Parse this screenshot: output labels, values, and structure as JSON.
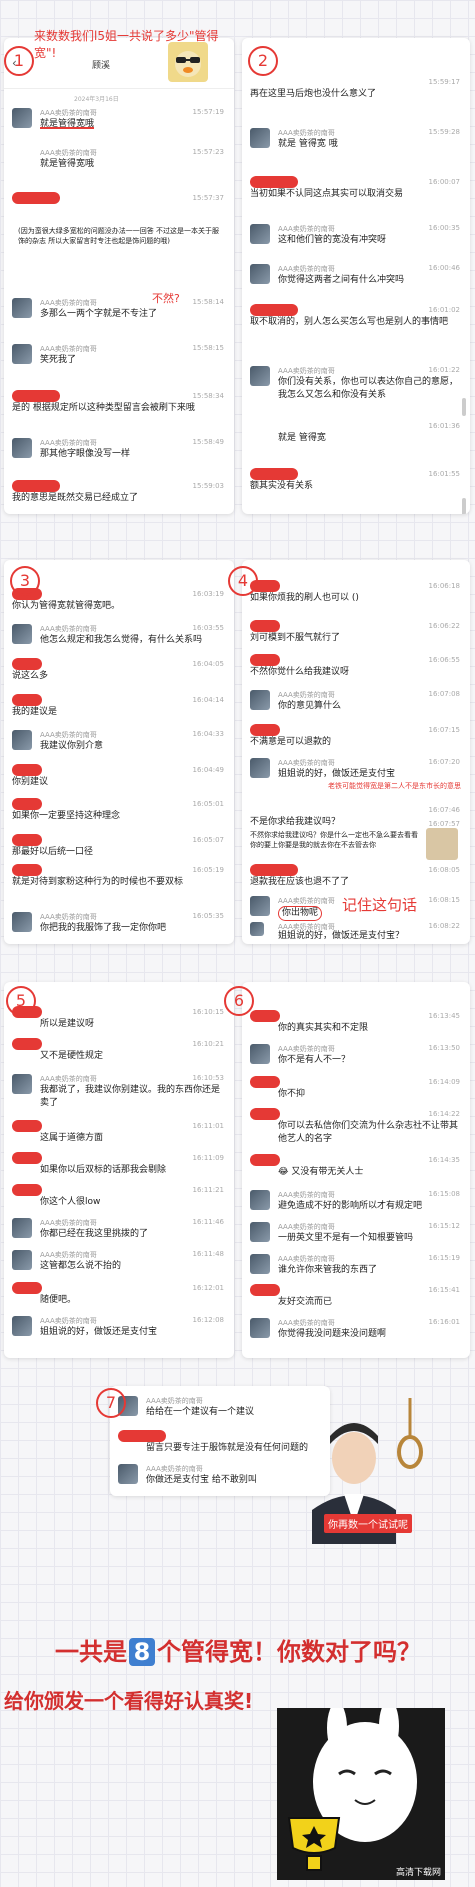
{
  "header": {
    "annotation": "来数数我们l5姐一共说了多少\"管得宽\"!",
    "chat_title": "顾溪",
    "chat_date": "2024年3月16日"
  },
  "panel_labels": [
    "1",
    "2",
    "3",
    "4",
    "5",
    "6",
    "7"
  ],
  "panel1": {
    "messages": [
      {
        "name": "AAA卖奶茶的南哥",
        "time": "15:57:19",
        "text": "就是管得宽哦"
      },
      {
        "name": "AAA卖奶茶的南哥",
        "time": "15:57:23",
        "text": "就是管得宽哦"
      },
      {
        "time": "15:57:37",
        "text": "(因为蛮很大绿多宽松的问题没办法一一回答  不过这是一本关于服饰的杂志  所以大家留言时专注也起是饰问题的哦)"
      },
      {
        "name": "AAA卖奶茶的南哥",
        "time": "15:58:14",
        "text": "多那么一两个字就是不专注了"
      },
      {
        "name": "AAA卖奶茶的南哥",
        "time": "15:58:15",
        "text": "笑死我了"
      },
      {
        "time": "15:58:34",
        "text": "是的  根据规定所以这种类型留言会被刷下来哦"
      },
      {
        "name": "AAA卖奶茶的南哥",
        "time": "15:58:49",
        "text": "那其他字眼像没写一样"
      },
      {
        "time": "15:59:03",
        "text": "我的意思是既然交易已经成立了"
      }
    ],
    "annotation": "不然?"
  },
  "panel2": {
    "messages": [
      {
        "time": "15:59:17",
        "text": "再在这里马后炮也没什么意义了"
      },
      {
        "name": "AAA卖奶茶的南哥",
        "time": "15:59:28",
        "text": "就是 管得宽 哦"
      },
      {
        "time": "16:00:07",
        "text": "当初如果不认同这点其实可以取消交易"
      },
      {
        "name": "AAA卖奶茶的南哥",
        "time": "16:00:35",
        "text": "这和他们管的宽没有冲突呀"
      },
      {
        "name": "AAA卖奶茶的南哥",
        "time": "16:00:46",
        "text": "你觉得这两者之间有什么冲突吗"
      },
      {
        "time": "16:01:02",
        "text": "取不取消的，别人怎么买怎么写也是别人的事情吧"
      },
      {
        "name": "AAA卖奶茶的南哥",
        "time": "16:01:22",
        "text": "你们没有关系，你也可以表达你自己的意愿，我怎么又怎么和你没有关系"
      },
      {
        "time": "16:01:36",
        "text": "就是 管得宽"
      },
      {
        "time": "16:01:55",
        "text": "额其实没有关系"
      }
    ]
  },
  "panel3": {
    "messages": [
      {
        "time": "16:03:19",
        "text": "你认为管得宽就管得宽吧。"
      },
      {
        "name": "AAA卖奶茶的南哥",
        "time": "16:03:55",
        "text": "他怎么规定和我怎么觉得，有什么关系吗"
      },
      {
        "time": "16:04:05",
        "text": "说这么多"
      },
      {
        "time": "16:04:14",
        "text": "我的建议是"
      },
      {
        "name": "AAA卖奶茶的南哥",
        "time": "16:04:33",
        "text": "我建议你别介意"
      },
      {
        "time": "16:04:49",
        "text": "你别建议"
      },
      {
        "time": "16:05:01",
        "text": "如果你一定要坚持这种理念"
      },
      {
        "time": "16:05:07",
        "text": "那最好以后统一口径"
      },
      {
        "time": "16:05:19",
        "text": "就是对待到家粉这种行为的时候也不要双标"
      },
      {
        "name": "AAA卖奶茶的南哥",
        "time": "16:05:35",
        "text": "你把我的我服饰了我一定你你吧"
      }
    ]
  },
  "panel4": {
    "messages": [
      {
        "time": "16:06:18",
        "text": "如果你烦我的刷人也可以 ()"
      },
      {
        "time": "16:06:22",
        "text": "刘可模到不服气就行了"
      },
      {
        "time": "16:06:55",
        "text": "不然你觉什么给我建议呀"
      },
      {
        "name": "AAA卖奶茶的南哥",
        "time": "16:07:08",
        "text": "你的意见算什么"
      },
      {
        "time": "16:07:15",
        "text": "不满意是可以退款的"
      },
      {
        "name": "AAA卖奶茶的南哥",
        "time": "16:07:20",
        "text": "姐姐说的好，做饭还是支付宝"
      },
      {
        "time": "16:07:46",
        "text": "不是你求给我建议吗？"
      },
      {
        "time": "16:07:57",
        "text": "不然你求给我建议吗？你是什么一定也不急么要去看看你的要上你要是我的就去你在不去管去你"
      },
      {
        "time": "16:08:05",
        "text": "退款我在应该也退不了了"
      },
      {
        "name": "AAA卖奶茶的南哥",
        "time": "16:08:15",
        "text": "你出物呢"
      },
      {
        "name": "AAA卖奶茶的南哥",
        "time": "16:08:22",
        "text": "姐姐说的好，做饭还是支付宝？"
      }
    ],
    "annotation_1": "老铁可能觉得宽是第二人不是东市长的意思",
    "annotation_2": "记住这句话"
  },
  "panel5": {
    "messages": [
      {
        "time": "16:10:15",
        "text": "所以是建议呀"
      },
      {
        "time": "16:10:21",
        "text": "又不是硬性规定"
      },
      {
        "name": "AAA卖奶茶的南哥",
        "time": "16:10:53",
        "text": "我都说了，我建议你别建议。我的东西你还是卖了"
      },
      {
        "time": "16:11:01",
        "text": "这属于道德方面"
      },
      {
        "time": "16:11:09",
        "text": "如果你以后双标的话那我会剔除"
      },
      {
        "time": "16:11:21",
        "text": "你这个人很low"
      },
      {
        "name": "AAA卖奶茶的南哥",
        "time": "16:11:46",
        "text": "你都已经在我这里挑拨的了"
      },
      {
        "name": "AAA卖奶茶的南哥",
        "time": "16:11:48",
        "text": "这管都怎么说不抬的"
      },
      {
        "time": "16:12:01",
        "text": "随便吧。"
      },
      {
        "name": "AAA卖奶茶的南哥",
        "time": "16:12:08",
        "text": "姐姐说的好，做饭还是支付宝"
      }
    ]
  },
  "panel6": {
    "messages": [
      {
        "time": "16:13:45",
        "text": "你的真实其实和不定限"
      },
      {
        "name": "AAA卖奶茶的南哥",
        "time": "16:13:50",
        "text": "你不是有人不一？"
      },
      {
        "time": "16:14:09",
        "text": "你不抑"
      },
      {
        "time": "16:14:22",
        "text": "你可以去私信你们交流为什么杂志社不让带其他艺人的名字"
      },
      {
        "time": "16:14:35",
        "text": "😂 又没有带无关人士"
      },
      {
        "name": "AAA卖奶茶的南哥",
        "time": "16:15:08",
        "text": "避免造成不好的影响所以才有规定吧"
      },
      {
        "name": "AAA卖奶茶的南哥",
        "time": "16:15:12",
        "text": "一册英文里不是有一个知根要管吗"
      },
      {
        "name": "AAA卖奶茶的南哥",
        "time": "16:15:19",
        "text": "谁允许你来管我的东西了"
      },
      {
        "time": "16:15:41",
        "text": "友好交流而已"
      },
      {
        "name": "AAA卖奶茶的南哥",
        "time": "16:16:01",
        "text": "你觉得我没问题来没问题啊"
      }
    ]
  },
  "panel7": {
    "messages": [
      {
        "name": "AAA卖奶茶的南哥",
        "time": "",
        "text": "给给在一个建议有一个建议"
      },
      {
        "time": "",
        "text": "留言只要专注于服饰就是没有任何问题的"
      },
      {
        "name": "AAA卖奶茶的南哥",
        "time": "",
        "text": "你做还是支付宝 给不敢别叫"
      }
    ],
    "meme_caption": "你再数一个试试呢"
  },
  "footer": {
    "line1_before": "一共是",
    "line1_num": "8",
    "line1_after": "个管得宽！你数对了吗？",
    "line2": "给你颁发一个看得好认真奖!",
    "watermark": "高清下载网"
  },
  "colors": {
    "accent_red": "#e53935",
    "background": "#f6f6f8"
  }
}
